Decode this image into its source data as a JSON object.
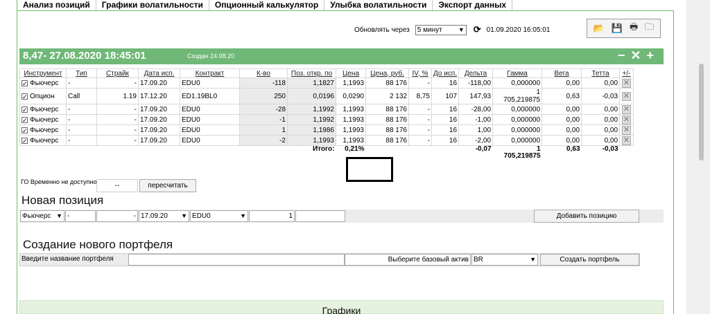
{
  "tabs": [
    "Анализ позиций",
    "Графики волатильности",
    "Опционный калькулятор",
    "Улыбка волатильности",
    "Экспорт данных"
  ],
  "refresh": {
    "label": "Обновлять через",
    "interval": "5 минут",
    "datetime": "01.09.2020 16:05:01"
  },
  "icons": [
    "open-folder-icon",
    "save-icon",
    "print-icon",
    "folder-icon"
  ],
  "portfolio": {
    "title": "8,47- 27.08.2020 18:45:01",
    "created": "Создан 24.08.20",
    "controls": [
      "−",
      "✕",
      "+"
    ]
  },
  "columns": [
    "Инструмент",
    "Тип",
    "Страйк",
    "Дата исп.",
    "Контракт",
    "К-во",
    "Поз. откр. по",
    "Цена",
    "Цена, руб.",
    "IV, %",
    "До исп.",
    "Дельта",
    "Гамма",
    "Вега",
    "Тетта",
    "+/-"
  ],
  "rows": [
    {
      "instrument": "Фьючерс",
      "type": "-",
      "strike": "-",
      "date": "17.09.20",
      "contract": "EDU0",
      "qty": "-118",
      "open": "1,1827",
      "price": "1,1993",
      "price_rub": "88 176",
      "iv": "-",
      "days": "16",
      "delta": "-118,00",
      "gamma": "0,000000",
      "vega": "0,00",
      "theta": "0,00"
    },
    {
      "instrument": "Опцион",
      "type": "Call",
      "strike": "1.19",
      "date": "17.12.20",
      "contract": "ED1.19BL0",
      "qty": "250",
      "open": "0,0196",
      "price": "0,0290",
      "price_rub": "2 132",
      "iv": "8,75",
      "days": "107",
      "delta": "147,93",
      "gamma": "1\n705,219875",
      "vega": "0,63",
      "theta": "-0,03"
    },
    {
      "instrument": "Фьючерс",
      "type": "-",
      "strike": "-",
      "date": "17.09.20",
      "contract": "EDU0",
      "qty": "-28",
      "open": "1,1992",
      "price": "1,1993",
      "price_rub": "88 176",
      "iv": "-",
      "days": "16",
      "delta": "-28,00",
      "gamma": "0,000000",
      "vega": "0,00",
      "theta": "0,00"
    },
    {
      "instrument": "Фьючерс",
      "type": "-",
      "strike": "-",
      "date": "17.09.20",
      "contract": "EDU0",
      "qty": "-1",
      "open": "1,1992",
      "price": "1,1993",
      "price_rub": "88 176",
      "iv": "-",
      "days": "16",
      "delta": "-1,00",
      "gamma": "0,000000",
      "vega": "0,00",
      "theta": "0,00"
    },
    {
      "instrument": "Фьючерс",
      "type": "-",
      "strike": "-",
      "date": "17.09.20",
      "contract": "EDU0",
      "qty": "1",
      "open": "1,1986",
      "price": "1,1993",
      "price_rub": "88 176",
      "iv": "-",
      "days": "16",
      "delta": "1,00",
      "gamma": "0,000000",
      "vega": "0,00",
      "theta": "0,00"
    },
    {
      "instrument": "Фьючерс",
      "type": "-",
      "strike": "-",
      "date": "17.09.20",
      "contract": "EDU0",
      "qty": "-2",
      "open": "1,1993",
      "price": "1,1993",
      "price_rub": "88 176",
      "iv": "-",
      "days": "16",
      "delta": "-2,00",
      "gamma": "0,000000",
      "vega": "0,00",
      "theta": "0,00"
    }
  ],
  "totals": {
    "label": "Итого:",
    "pnl": "0,21%",
    "delta": "-0,07",
    "gamma": "1\n705,219875",
    "vega": "0,63",
    "theta": "-0,03"
  },
  "go": {
    "label": "ГО Временно не доступно",
    "value": "--",
    "recalc": "пересчитать"
  },
  "new_position": {
    "title": "Новая позиция",
    "instrument": "Фьючерс",
    "type": "-",
    "strike": "-",
    "date": "17.09.20",
    "contract": "EDU0",
    "qty": "1",
    "add": "Добавить позицию"
  },
  "new_portfolio": {
    "title": "Создание нового портфеля",
    "name_placeholder": "Введите название портфеля",
    "base_label": "Выберите базовый актив",
    "base_value": "BR",
    "create": "Создать портфель"
  },
  "charts_title": "Графики"
}
